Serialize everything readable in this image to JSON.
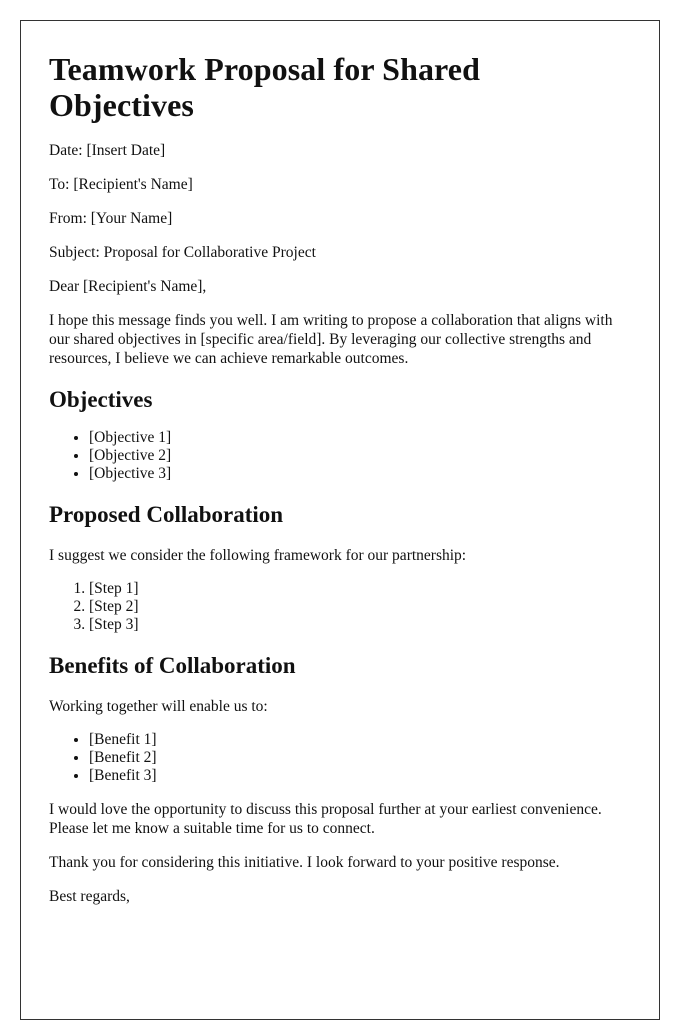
{
  "title": "Teamwork Proposal for Shared Objectives",
  "header_fields": {
    "date": "Date: [Insert Date]",
    "to": "To: [Recipient's Name]",
    "from": "From: [Your Name]",
    "subject": "Subject: Proposal for Collaborative Project"
  },
  "salutation": "Dear [Recipient's Name],",
  "intro": "I hope this message finds you well. I am writing to propose a collaboration that aligns with our shared objectives in [specific area/field]. By leveraging our collective strengths and resources, I believe we can achieve remarkable outcomes.",
  "objectives": {
    "heading": "Objectives",
    "items": [
      "[Objective 1]",
      "[Objective 2]",
      "[Objective 3]"
    ]
  },
  "collaboration": {
    "heading": "Proposed Collaboration",
    "intro": "I suggest we consider the following framework for our partnership:",
    "steps": [
      "[Step 1]",
      "[Step 2]",
      "[Step 3]"
    ]
  },
  "benefits": {
    "heading": "Benefits of Collaboration",
    "intro": "Working together will enable us to:",
    "items": [
      "[Benefit 1]",
      "[Benefit 2]",
      "[Benefit 3]"
    ]
  },
  "closing_paragraph": "I would love the opportunity to discuss this proposal further at your earliest convenience. Please let me know a suitable time for us to connect.",
  "thanks": "Thank you for considering this initiative. I look forward to your positive response.",
  "signoff": "Best regards,"
}
